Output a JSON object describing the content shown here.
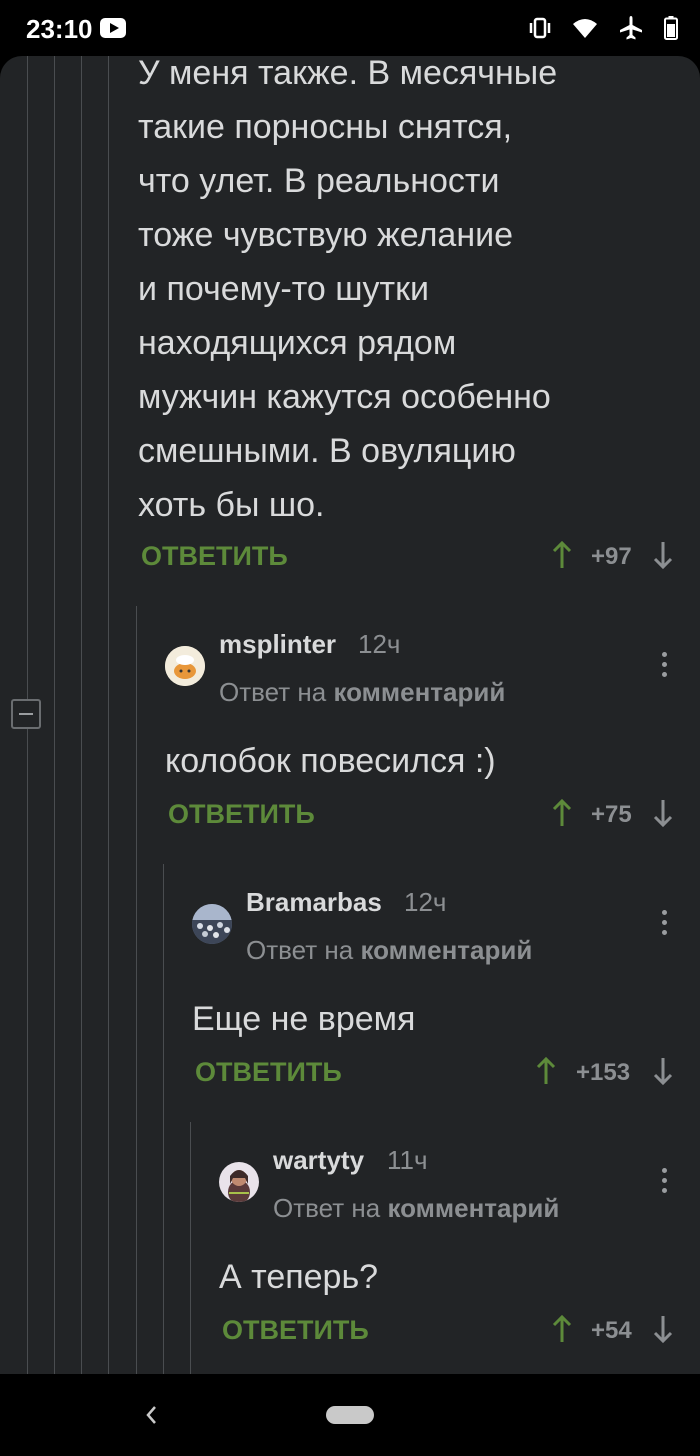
{
  "status": {
    "time": "23:10"
  },
  "thread": {
    "top": {
      "text_lines": [
        "У меня также. В месячные",
        "такие порносны снятся,",
        "что улет. В реальности",
        "тоже чувствую желание",
        "и почему-то шутки",
        "находящихся рядом",
        "мужчин кажутся особенно",
        "смешными. В овуляцию",
        "хоть бы шо."
      ],
      "reply_label": "ОТВЕТИТЬ",
      "score": "+97"
    },
    "comments": [
      {
        "username": "msplinter",
        "time": "12ч",
        "reply_prefix": "Ответ на ",
        "reply_target": "комментарий",
        "text": "колобок повесился :)",
        "reply_label": "ОТВЕТИТЬ",
        "score": "+75"
      },
      {
        "username": "Bramarbas",
        "time": "12ч",
        "reply_prefix": "Ответ на ",
        "reply_target": "комментарий",
        "text": "Еще не время",
        "reply_label": "ОТВЕТИТЬ",
        "score": "+153"
      },
      {
        "username": "wartyty",
        "time": "11ч",
        "reply_prefix": "Ответ на ",
        "reply_target": "комментарий",
        "text": "А теперь?",
        "reply_label": "ОТВЕТИТЬ",
        "score": "+54"
      }
    ]
  },
  "colors": {
    "background": "#222426",
    "accent_green": "#5d8a3a",
    "text": "#d9dadb",
    "muted": "#8c8f92"
  },
  "icons": [
    "vibrate-icon",
    "wifi-icon",
    "airplane-icon",
    "battery-icon",
    "youtube-icon",
    "arrow-up-icon",
    "arrow-down-icon",
    "more-vertical-icon",
    "collapse-icon",
    "back-icon"
  ]
}
